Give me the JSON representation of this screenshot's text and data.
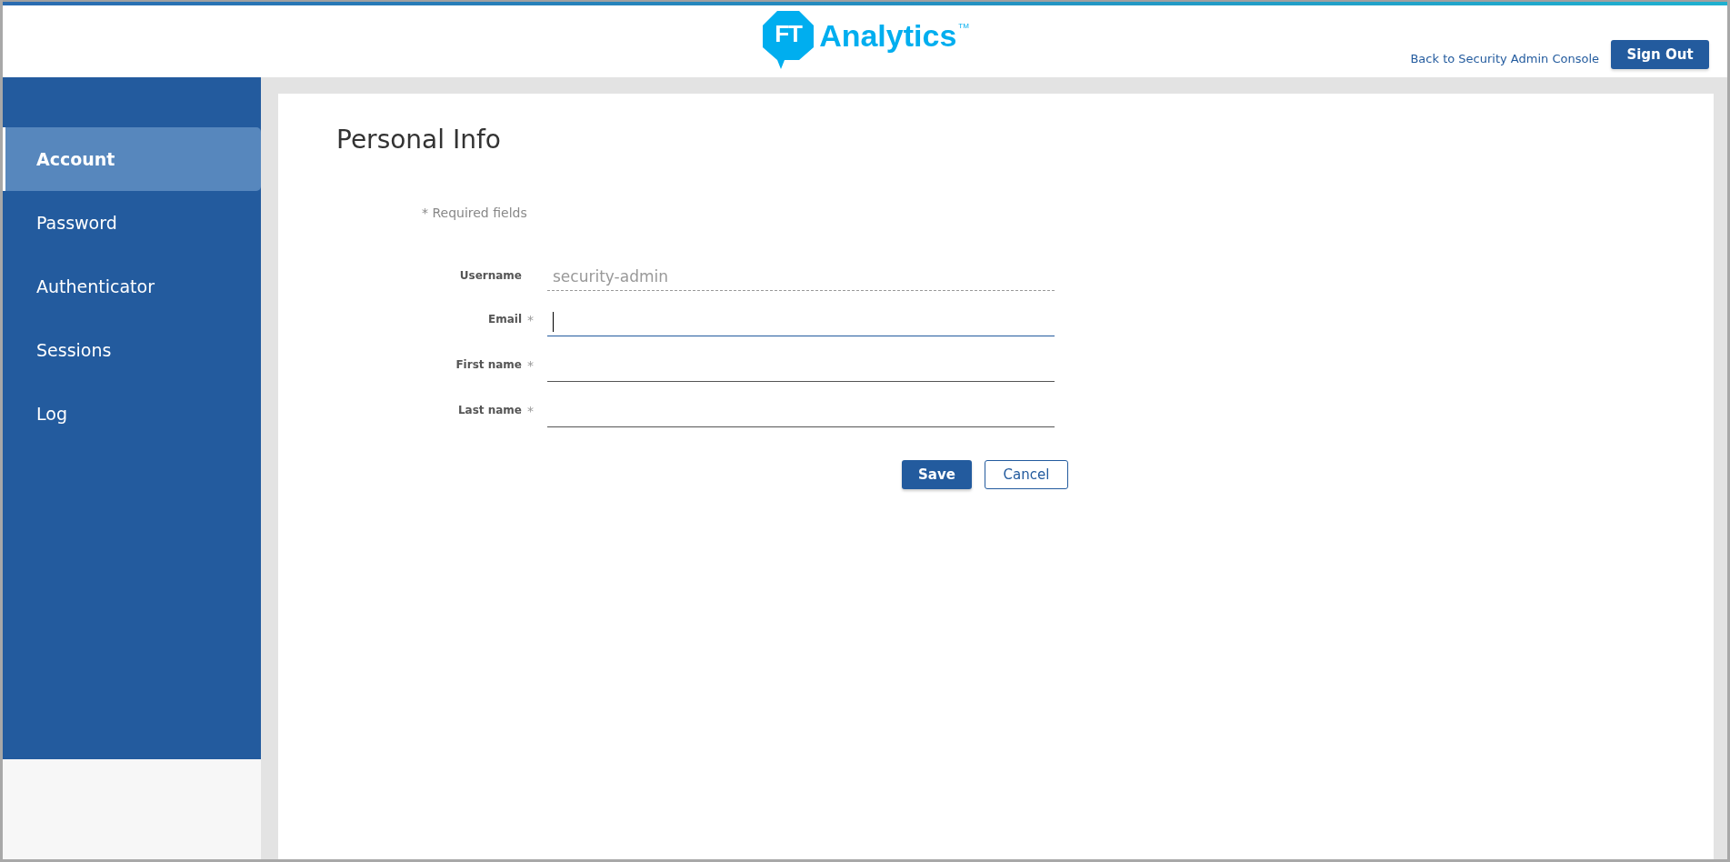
{
  "header": {
    "logo": {
      "badge": "FT",
      "name": "Analytics",
      "trademark": "TM"
    },
    "back_link": "Back to Security Admin Console",
    "sign_out": "Sign Out"
  },
  "sidebar": {
    "items": [
      {
        "label": "Account",
        "selected": true
      },
      {
        "label": "Password",
        "selected": false
      },
      {
        "label": "Authenticator",
        "selected": false
      },
      {
        "label": "Sessions",
        "selected": false
      },
      {
        "label": "Log",
        "selected": false
      }
    ]
  },
  "page": {
    "title": "Personal Info",
    "required_note": "* Required fields",
    "fields": [
      {
        "label": "Username",
        "kind": "readonly",
        "value": "security-admin"
      },
      {
        "label": "Email",
        "kind": "input",
        "marker": "*",
        "focused": true
      },
      {
        "label": "First name",
        "kind": "input",
        "marker": "*",
        "focused": false
      },
      {
        "label": "Last name",
        "kind": "input",
        "marker": "*",
        "focused": false
      }
    ],
    "buttons": [
      {
        "label": "Save",
        "kind": "primary"
      },
      {
        "label": "Cancel",
        "kind": "secondary"
      }
    ]
  }
}
